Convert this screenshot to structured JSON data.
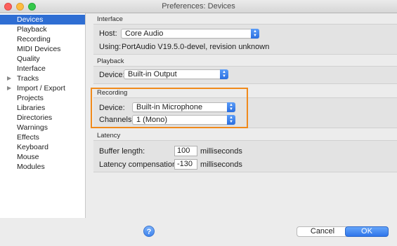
{
  "window": {
    "title": "Preferences: Devices"
  },
  "sidebar": {
    "items": [
      {
        "label": "Devices",
        "selected": true,
        "expandable": false
      },
      {
        "label": "Playback",
        "selected": false,
        "expandable": false
      },
      {
        "label": "Recording",
        "selected": false,
        "expandable": false
      },
      {
        "label": "MIDI Devices",
        "selected": false,
        "expandable": false
      },
      {
        "label": "Quality",
        "selected": false,
        "expandable": false
      },
      {
        "label": "Interface",
        "selected": false,
        "expandable": false
      },
      {
        "label": "Tracks",
        "selected": false,
        "expandable": true
      },
      {
        "label": "Import / Export",
        "selected": false,
        "expandable": true
      },
      {
        "label": "Projects",
        "selected": false,
        "expandable": false
      },
      {
        "label": "Libraries",
        "selected": false,
        "expandable": false
      },
      {
        "label": "Directories",
        "selected": false,
        "expandable": false
      },
      {
        "label": "Warnings",
        "selected": false,
        "expandable": false
      },
      {
        "label": "Effects",
        "selected": false,
        "expandable": false
      },
      {
        "label": "Keyboard",
        "selected": false,
        "expandable": false
      },
      {
        "label": "Mouse",
        "selected": false,
        "expandable": false
      },
      {
        "label": "Modules",
        "selected": false,
        "expandable": false
      }
    ]
  },
  "interface": {
    "section_title": "Interface",
    "host_label": "Host:",
    "host_value": "Core Audio",
    "using_label": "Using:",
    "using_value": "PortAudio V19.5.0-devel, revision unknown"
  },
  "playback": {
    "section_title": "Playback",
    "device_label": "Device:",
    "device_value": "Built-in Output"
  },
  "recording": {
    "section_title": "Recording",
    "device_label": "Device:",
    "device_value": "Built-in Microphone",
    "channels_label": "Channels:",
    "channels_value": "1 (Mono)"
  },
  "latency": {
    "section_title": "Latency",
    "buffer_label": "Buffer length:",
    "buffer_value": "100",
    "buffer_unit": "milliseconds",
    "compensation_label": "Latency compensation:",
    "compensation_value": "-130",
    "compensation_unit": "milliseconds"
  },
  "footer": {
    "help_label": "?",
    "cancel_label": "Cancel",
    "ok_label": "OK"
  },
  "colors": {
    "selection": "#2f6ed3",
    "highlight_box": "#f08a1c",
    "accent": "#2f75ea"
  },
  "icons": {
    "expand": "triangle-right-icon",
    "popup": "chevron-updown-icon",
    "help": "question-mark-icon"
  }
}
